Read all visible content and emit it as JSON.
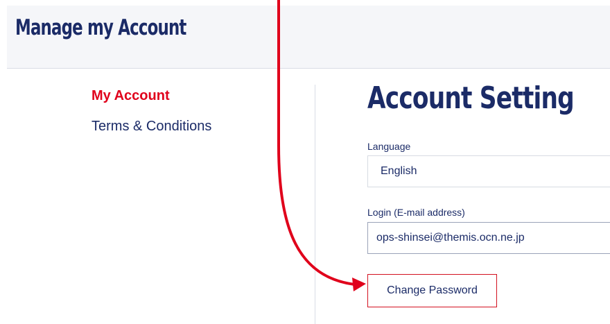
{
  "header": {
    "title": "Manage my Account"
  },
  "sidebar": {
    "items": [
      {
        "label": "My Account",
        "active": true
      },
      {
        "label": "Terms & Conditions",
        "active": false
      }
    ]
  },
  "main": {
    "title": "Account Setting",
    "language": {
      "label": "Language",
      "value": "English"
    },
    "login": {
      "label": "Login (E-mail address)",
      "value": "ops-shinsei@themis.ocn.ne.jp"
    },
    "change_password_label": "Change Password"
  },
  "annotation": {
    "arrow_color": "#e0001b"
  },
  "colors": {
    "brand_navy": "#1b2b67",
    "accent_red": "#e0001b"
  }
}
